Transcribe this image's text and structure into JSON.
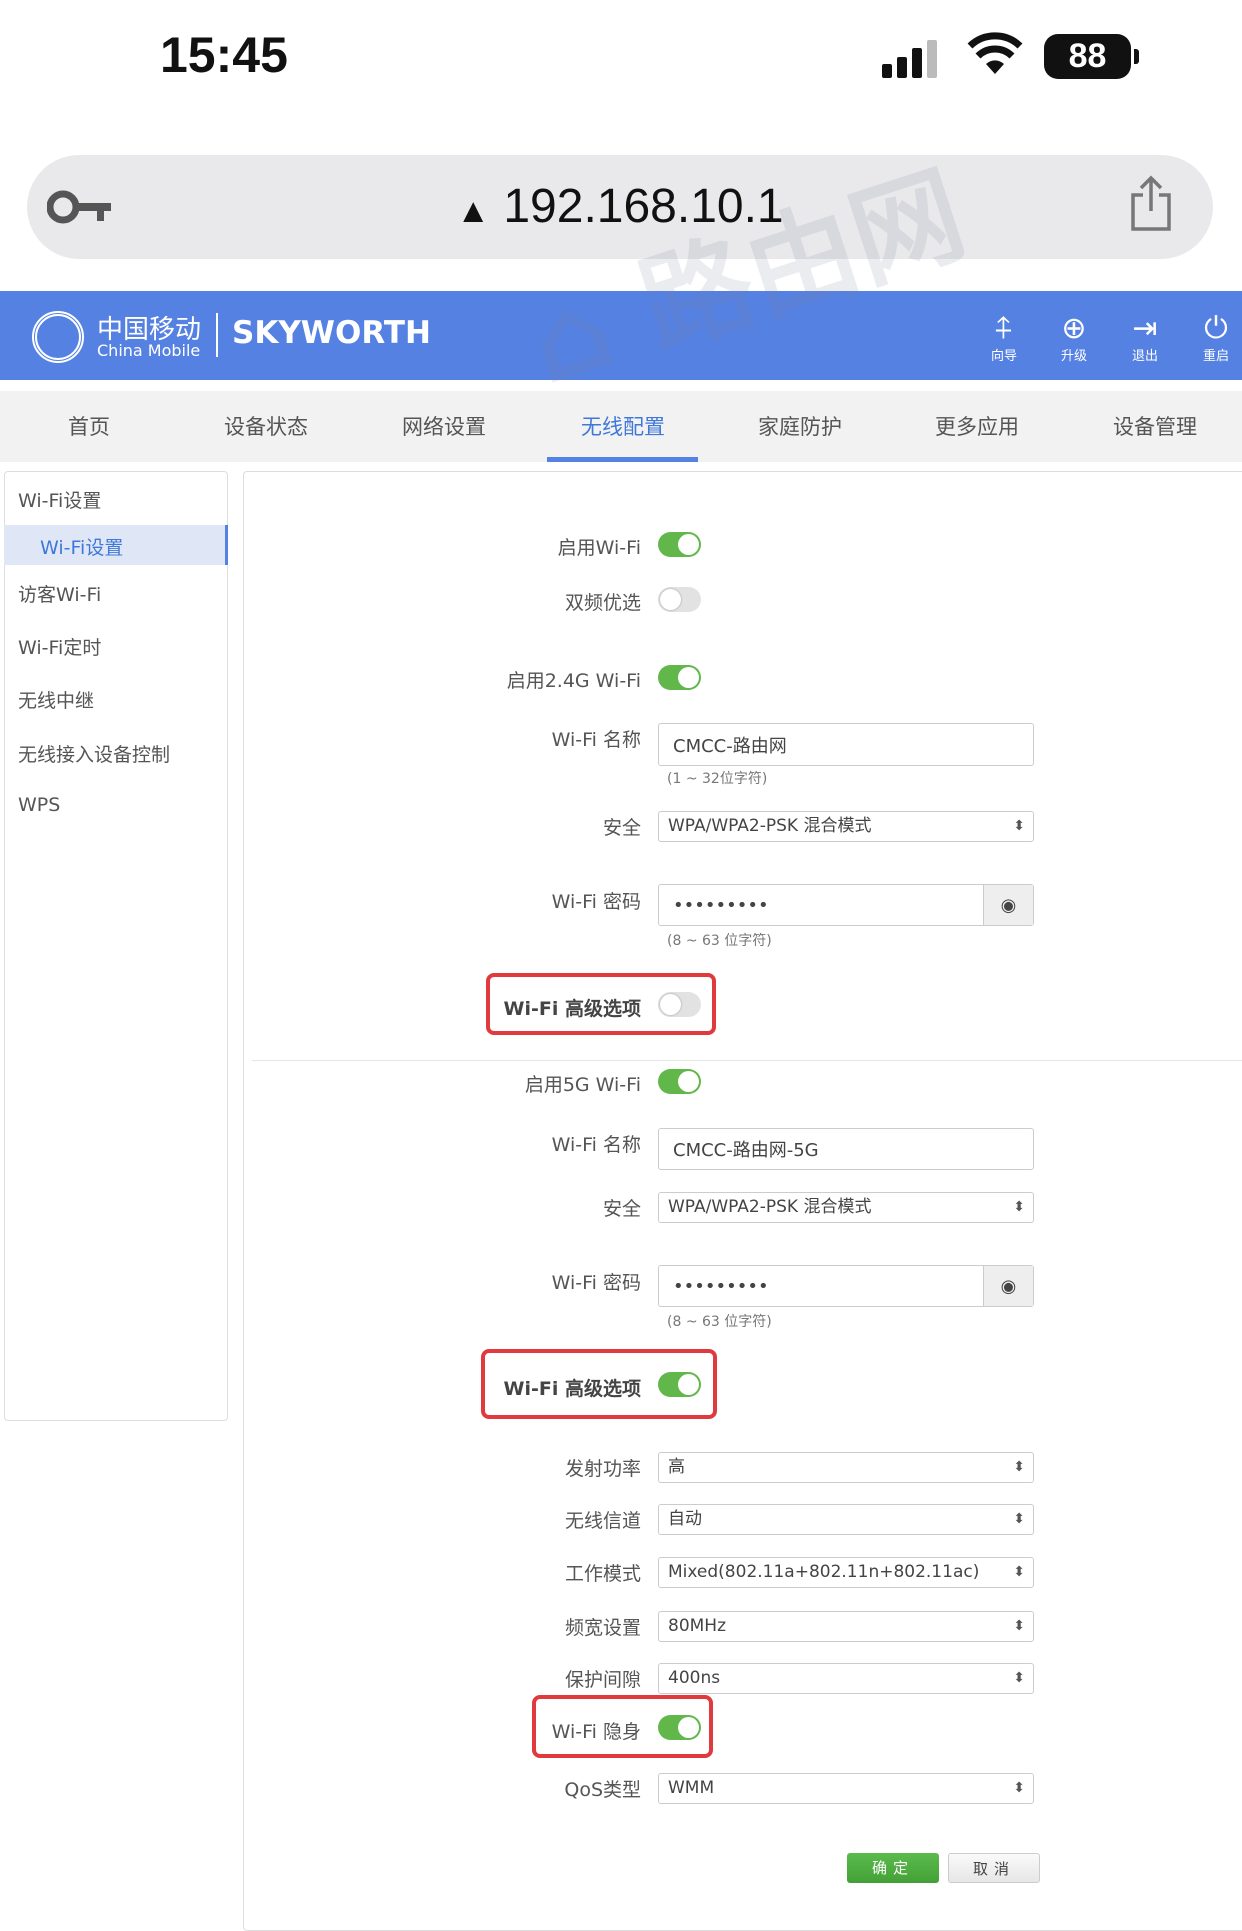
{
  "status_bar": {
    "time": "15:45",
    "battery": "88"
  },
  "browser": {
    "url": "192.168.10.1",
    "warning_icon": "warning-triangle-icon",
    "key_icon": "key-icon",
    "share_icon": "share-icon"
  },
  "watermark": "路由网",
  "header": {
    "logo_cn": "中国移动",
    "logo_en": "China Mobile",
    "brand": "SKYWORTH",
    "actions": [
      {
        "icon": "signpost-icon",
        "label": "向导"
      },
      {
        "icon": "upgrade-icon",
        "label": "升级"
      },
      {
        "icon": "logout-icon",
        "label": "退出"
      },
      {
        "icon": "power-icon",
        "label": "重启"
      }
    ]
  },
  "nav": {
    "tabs": [
      "首页",
      "设备状态",
      "网络设置",
      "无线配置",
      "家庭防护",
      "更多应用",
      "设备管理"
    ],
    "active": "无线配置"
  },
  "sidebar": {
    "group": "Wi-Fi设置",
    "active": "Wi-Fi设置",
    "items": [
      "访客Wi-Fi",
      "Wi-Fi定时",
      "无线中继",
      "无线接入设备控制",
      "WPS"
    ]
  },
  "form": {
    "enable_wifi": {
      "label": "启用Wi-Fi",
      "on": true
    },
    "dual_band": {
      "label": "双频优选",
      "on": false
    },
    "band24": {
      "enable_label": "启用2.4G Wi-Fi",
      "on": true,
      "ssid_label": "Wi-Fi 名称",
      "ssid": "CMCC-路由网",
      "ssid_hint": "(1 ~ 32位字符)",
      "security_label": "安全",
      "security": "WPA/WPA2-PSK 混合模式",
      "password_label": "Wi-Fi 密码",
      "password": "•••••••••",
      "password_hint": "(8 ~ 63 位字符)",
      "advanced_label": "Wi-Fi 高级选项",
      "advanced_on": false
    },
    "band5": {
      "enable_label": "启用5G Wi-Fi",
      "on": true,
      "ssid_label": "Wi-Fi 名称",
      "ssid": "CMCC-路由网-5G",
      "security_label": "安全",
      "security": "WPA/WPA2-PSK 混合模式",
      "password_label": "Wi-Fi 密码",
      "password": "•••••••••",
      "password_hint": "(8 ~ 63 位字符)",
      "advanced_label": "Wi-Fi 高级选项",
      "advanced_on": true
    },
    "advanced": {
      "tx_power": {
        "label": "发射功率",
        "value": "高"
      },
      "channel": {
        "label": "无线信道",
        "value": "自动"
      },
      "mode": {
        "label": "工作模式",
        "value": "Mixed(802.11a+802.11n+802.11ac)"
      },
      "bandwidth": {
        "label": "频宽设置",
        "value": "80MHz"
      },
      "guard": {
        "label": "保护间隙",
        "value": "400ns"
      },
      "hidden": {
        "label": "Wi-Fi 隐身",
        "on": true
      },
      "qos": {
        "label": "QoS类型",
        "value": "WMM"
      }
    },
    "confirm": "确定",
    "cancel": "取消"
  },
  "colors": {
    "header": "#5581e3",
    "toggle_on": "#62b74a",
    "highlight": "#e0393e",
    "confirm": "#4caa3f"
  }
}
